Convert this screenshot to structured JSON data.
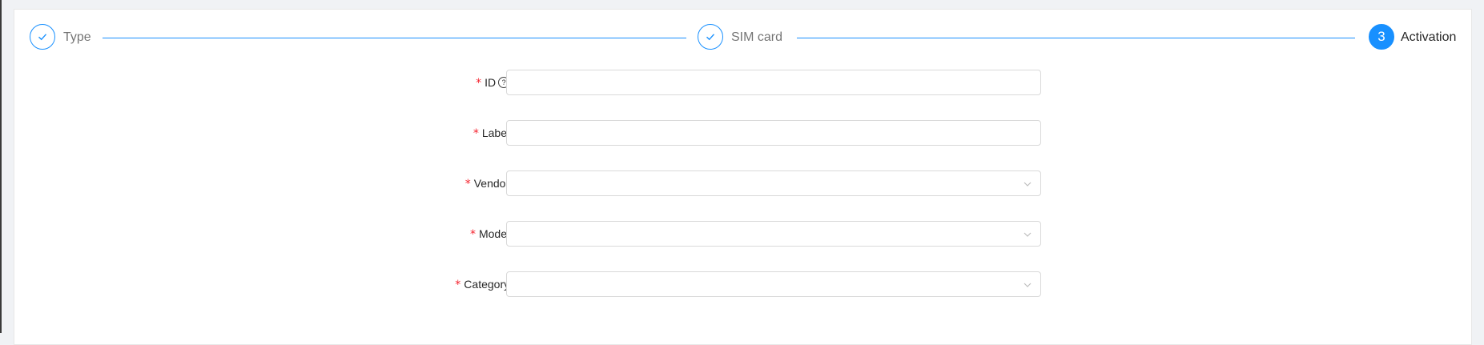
{
  "steps": [
    {
      "title": "Type",
      "status": "finish",
      "icon": "check-icon"
    },
    {
      "title": "SIM card",
      "status": "finish",
      "icon": "check-icon"
    },
    {
      "title": "Activation",
      "status": "process",
      "number": "3"
    }
  ],
  "form": {
    "required_mark": "*",
    "fields": {
      "id": {
        "label": "ID",
        "value": "",
        "help_icon": "question-circle-icon"
      },
      "label": {
        "label": "Label",
        "value": ""
      },
      "vendor": {
        "label": "Vendor",
        "selected": ""
      },
      "model": {
        "label": "Model",
        "selected": ""
      },
      "category": {
        "label": "Category",
        "selected": ""
      }
    }
  },
  "colors": {
    "primary": "#1890ff",
    "required": "#f5222d",
    "border": "#d9d9d9"
  }
}
